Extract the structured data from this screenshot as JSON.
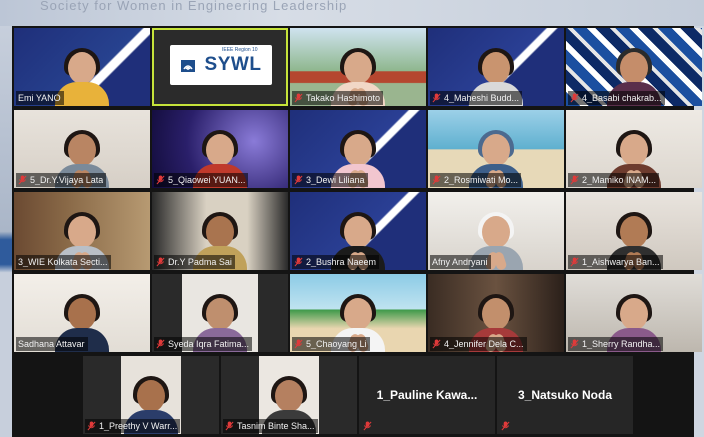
{
  "background_text": "Society for Women in Engineering Leadership",
  "sywl_logo": {
    "text": "SYWL",
    "subtext": "IEEE Region 10"
  },
  "participants": [
    {
      "name": "Emi YANO",
      "muted": false
    },
    {
      "name": "",
      "muted": false
    },
    {
      "name": "Takako Hashimoto",
      "muted": true
    },
    {
      "name": "4_Maheshi Budd...",
      "muted": true
    },
    {
      "name": "4_Basabi chakrab...",
      "muted": true
    },
    {
      "name": "5_Dr.Y.Vijaya Lata",
      "muted": true
    },
    {
      "name": "5_Qiaowei YUAN...",
      "muted": true
    },
    {
      "name": "3_Dewi Liliana",
      "muted": true
    },
    {
      "name": "2_Rosmiwati Mo...",
      "muted": true
    },
    {
      "name": "2_Mamiko INAM...",
      "muted": true
    },
    {
      "name": "3_WIE Kolkata Secti...",
      "muted": false
    },
    {
      "name": "Dr.Y Padma Sai",
      "muted": true
    },
    {
      "name": "2_Bushra Naeem",
      "muted": true
    },
    {
      "name": "Afny Andryani",
      "muted": false
    },
    {
      "name": "1_Aishwarya Ban...",
      "muted": true
    },
    {
      "name": "Sadhana Attavar",
      "muted": false
    },
    {
      "name": "Syeda Iqra Fatima...",
      "muted": true
    },
    {
      "name": "5_Chaoyang Li",
      "muted": true
    },
    {
      "name": "4_Jennifer Dela C...",
      "muted": true
    },
    {
      "name": "1_Sherry Randha...",
      "muted": true
    },
    {
      "name": "1_Preethy V Warr...",
      "muted": true
    },
    {
      "name": "Tasnim Binte Sha...",
      "muted": true
    },
    {
      "name": "1_Pauline Kawa...",
      "muted": true
    },
    {
      "name": "3_Natsuko Noda",
      "muted": true
    }
  ],
  "colors": {
    "active_speaker_border": "#c6e33a",
    "muted_icon": "#e03a3a"
  }
}
